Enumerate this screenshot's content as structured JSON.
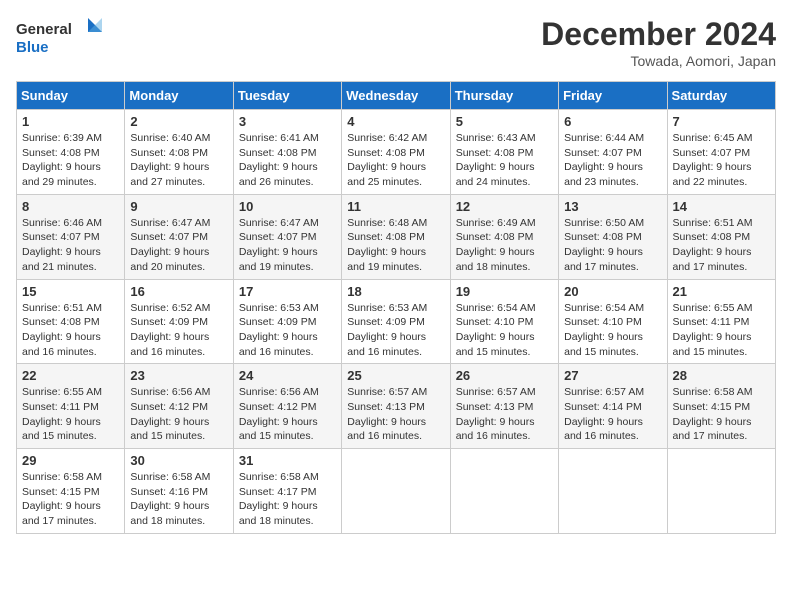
{
  "header": {
    "logo_line1": "General",
    "logo_line2": "Blue",
    "month_title": "December 2024",
    "location": "Towada, Aomori, Japan"
  },
  "days_of_week": [
    "Sunday",
    "Monday",
    "Tuesday",
    "Wednesday",
    "Thursday",
    "Friday",
    "Saturday"
  ],
  "weeks": [
    [
      {
        "day": "1",
        "sunrise": "Sunrise: 6:39 AM",
        "sunset": "Sunset: 4:08 PM",
        "daylight": "Daylight: 9 hours and 29 minutes."
      },
      {
        "day": "2",
        "sunrise": "Sunrise: 6:40 AM",
        "sunset": "Sunset: 4:08 PM",
        "daylight": "Daylight: 9 hours and 27 minutes."
      },
      {
        "day": "3",
        "sunrise": "Sunrise: 6:41 AM",
        "sunset": "Sunset: 4:08 PM",
        "daylight": "Daylight: 9 hours and 26 minutes."
      },
      {
        "day": "4",
        "sunrise": "Sunrise: 6:42 AM",
        "sunset": "Sunset: 4:08 PM",
        "daylight": "Daylight: 9 hours and 25 minutes."
      },
      {
        "day": "5",
        "sunrise": "Sunrise: 6:43 AM",
        "sunset": "Sunset: 4:08 PM",
        "daylight": "Daylight: 9 hours and 24 minutes."
      },
      {
        "day": "6",
        "sunrise": "Sunrise: 6:44 AM",
        "sunset": "Sunset: 4:07 PM",
        "daylight": "Daylight: 9 hours and 23 minutes."
      },
      {
        "day": "7",
        "sunrise": "Sunrise: 6:45 AM",
        "sunset": "Sunset: 4:07 PM",
        "daylight": "Daylight: 9 hours and 22 minutes."
      }
    ],
    [
      {
        "day": "8",
        "sunrise": "Sunrise: 6:46 AM",
        "sunset": "Sunset: 4:07 PM",
        "daylight": "Daylight: 9 hours and 21 minutes."
      },
      {
        "day": "9",
        "sunrise": "Sunrise: 6:47 AM",
        "sunset": "Sunset: 4:07 PM",
        "daylight": "Daylight: 9 hours and 20 minutes."
      },
      {
        "day": "10",
        "sunrise": "Sunrise: 6:47 AM",
        "sunset": "Sunset: 4:07 PM",
        "daylight": "Daylight: 9 hours and 19 minutes."
      },
      {
        "day": "11",
        "sunrise": "Sunrise: 6:48 AM",
        "sunset": "Sunset: 4:08 PM",
        "daylight": "Daylight: 9 hours and 19 minutes."
      },
      {
        "day": "12",
        "sunrise": "Sunrise: 6:49 AM",
        "sunset": "Sunset: 4:08 PM",
        "daylight": "Daylight: 9 hours and 18 minutes."
      },
      {
        "day": "13",
        "sunrise": "Sunrise: 6:50 AM",
        "sunset": "Sunset: 4:08 PM",
        "daylight": "Daylight: 9 hours and 17 minutes."
      },
      {
        "day": "14",
        "sunrise": "Sunrise: 6:51 AM",
        "sunset": "Sunset: 4:08 PM",
        "daylight": "Daylight: 9 hours and 17 minutes."
      }
    ],
    [
      {
        "day": "15",
        "sunrise": "Sunrise: 6:51 AM",
        "sunset": "Sunset: 4:08 PM",
        "daylight": "Daylight: 9 hours and 16 minutes."
      },
      {
        "day": "16",
        "sunrise": "Sunrise: 6:52 AM",
        "sunset": "Sunset: 4:09 PM",
        "daylight": "Daylight: 9 hours and 16 minutes."
      },
      {
        "day": "17",
        "sunrise": "Sunrise: 6:53 AM",
        "sunset": "Sunset: 4:09 PM",
        "daylight": "Daylight: 9 hours and 16 minutes."
      },
      {
        "day": "18",
        "sunrise": "Sunrise: 6:53 AM",
        "sunset": "Sunset: 4:09 PM",
        "daylight": "Daylight: 9 hours and 16 minutes."
      },
      {
        "day": "19",
        "sunrise": "Sunrise: 6:54 AM",
        "sunset": "Sunset: 4:10 PM",
        "daylight": "Daylight: 9 hours and 15 minutes."
      },
      {
        "day": "20",
        "sunrise": "Sunrise: 6:54 AM",
        "sunset": "Sunset: 4:10 PM",
        "daylight": "Daylight: 9 hours and 15 minutes."
      },
      {
        "day": "21",
        "sunrise": "Sunrise: 6:55 AM",
        "sunset": "Sunset: 4:11 PM",
        "daylight": "Daylight: 9 hours and 15 minutes."
      }
    ],
    [
      {
        "day": "22",
        "sunrise": "Sunrise: 6:55 AM",
        "sunset": "Sunset: 4:11 PM",
        "daylight": "Daylight: 9 hours and 15 minutes."
      },
      {
        "day": "23",
        "sunrise": "Sunrise: 6:56 AM",
        "sunset": "Sunset: 4:12 PM",
        "daylight": "Daylight: 9 hours and 15 minutes."
      },
      {
        "day": "24",
        "sunrise": "Sunrise: 6:56 AM",
        "sunset": "Sunset: 4:12 PM",
        "daylight": "Daylight: 9 hours and 15 minutes."
      },
      {
        "day": "25",
        "sunrise": "Sunrise: 6:57 AM",
        "sunset": "Sunset: 4:13 PM",
        "daylight": "Daylight: 9 hours and 16 minutes."
      },
      {
        "day": "26",
        "sunrise": "Sunrise: 6:57 AM",
        "sunset": "Sunset: 4:13 PM",
        "daylight": "Daylight: 9 hours and 16 minutes."
      },
      {
        "day": "27",
        "sunrise": "Sunrise: 6:57 AM",
        "sunset": "Sunset: 4:14 PM",
        "daylight": "Daylight: 9 hours and 16 minutes."
      },
      {
        "day": "28",
        "sunrise": "Sunrise: 6:58 AM",
        "sunset": "Sunset: 4:15 PM",
        "daylight": "Daylight: 9 hours and 17 minutes."
      }
    ],
    [
      {
        "day": "29",
        "sunrise": "Sunrise: 6:58 AM",
        "sunset": "Sunset: 4:15 PM",
        "daylight": "Daylight: 9 hours and 17 minutes."
      },
      {
        "day": "30",
        "sunrise": "Sunrise: 6:58 AM",
        "sunset": "Sunset: 4:16 PM",
        "daylight": "Daylight: 9 hours and 18 minutes."
      },
      {
        "day": "31",
        "sunrise": "Sunrise: 6:58 AM",
        "sunset": "Sunset: 4:17 PM",
        "daylight": "Daylight: 9 hours and 18 minutes."
      },
      null,
      null,
      null,
      null
    ]
  ]
}
